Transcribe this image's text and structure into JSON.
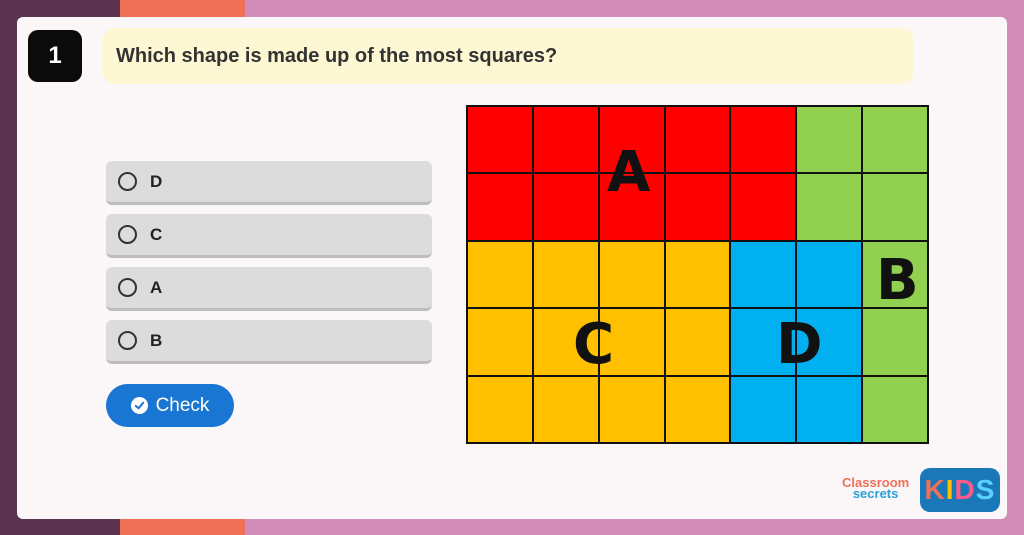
{
  "question": {
    "number": "1",
    "text": "Which shape is made up of the most squares?"
  },
  "options": [
    {
      "label": "D"
    },
    {
      "label": "C"
    },
    {
      "label": "A"
    },
    {
      "label": "B"
    }
  ],
  "check_button": {
    "label": "Check",
    "icon": "check-circle-icon"
  },
  "grid": {
    "rows": 5,
    "cols": 7,
    "colors": {
      "A": "#ff0000",
      "B": "#92d050",
      "C": "#ffc000",
      "D": "#00b0f0"
    },
    "cells": [
      [
        "A",
        "A",
        "A",
        "A",
        "A",
        "B",
        "B"
      ],
      [
        "A",
        "A",
        "A",
        "A",
        "A",
        "B",
        "B"
      ],
      [
        "C",
        "C",
        "C",
        "C",
        "D",
        "D",
        "B"
      ],
      [
        "C",
        "C",
        "C",
        "C",
        "D",
        "D",
        "B"
      ],
      [
        "C",
        "C",
        "C",
        "C",
        "D",
        "D",
        "B"
      ]
    ],
    "labels": {
      "A": "A",
      "B": "B",
      "C": "C",
      "D": "D"
    }
  },
  "branding": {
    "classroom_line1": "Classroom",
    "classroom_line2": "secrets",
    "kids": "KIDS"
  }
}
